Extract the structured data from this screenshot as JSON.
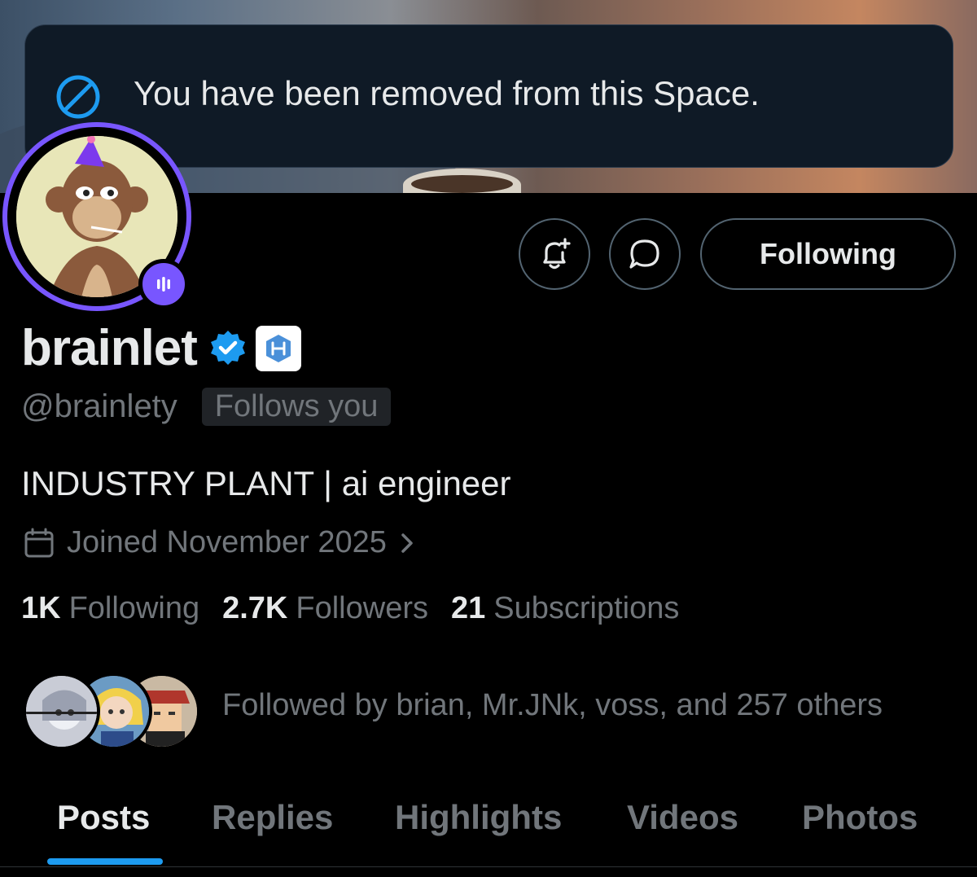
{
  "toast": {
    "icon": "blocked-circle-icon",
    "message": "You have been removed from this Space."
  },
  "profile": {
    "display_name": "brainlet",
    "handle": "@brainlety",
    "follows_you": "Follows you",
    "bio": "INDUSTRY PLANT | ai engineer",
    "joined": "Joined November 2025",
    "verified_color": "#1d9bf0",
    "space_ring_color": "#7856ff"
  },
  "actions": {
    "following_label": "Following"
  },
  "stats": {
    "following_count": "1K",
    "following_label": "Following",
    "followers_count": "2.7K",
    "followers_label": "Followers",
    "subscriptions_count": "21",
    "subscriptions_label": "Subscriptions"
  },
  "followed_by": "Followed by brian, Mr.JNk, voss, and 257 others",
  "tabs": [
    {
      "label": "Posts",
      "active": true
    },
    {
      "label": "Replies",
      "active": false
    },
    {
      "label": "Highlights",
      "active": false
    },
    {
      "label": "Videos",
      "active": false
    },
    {
      "label": "Photos",
      "active": false
    }
  ],
  "accent_color": "#1d9bf0"
}
